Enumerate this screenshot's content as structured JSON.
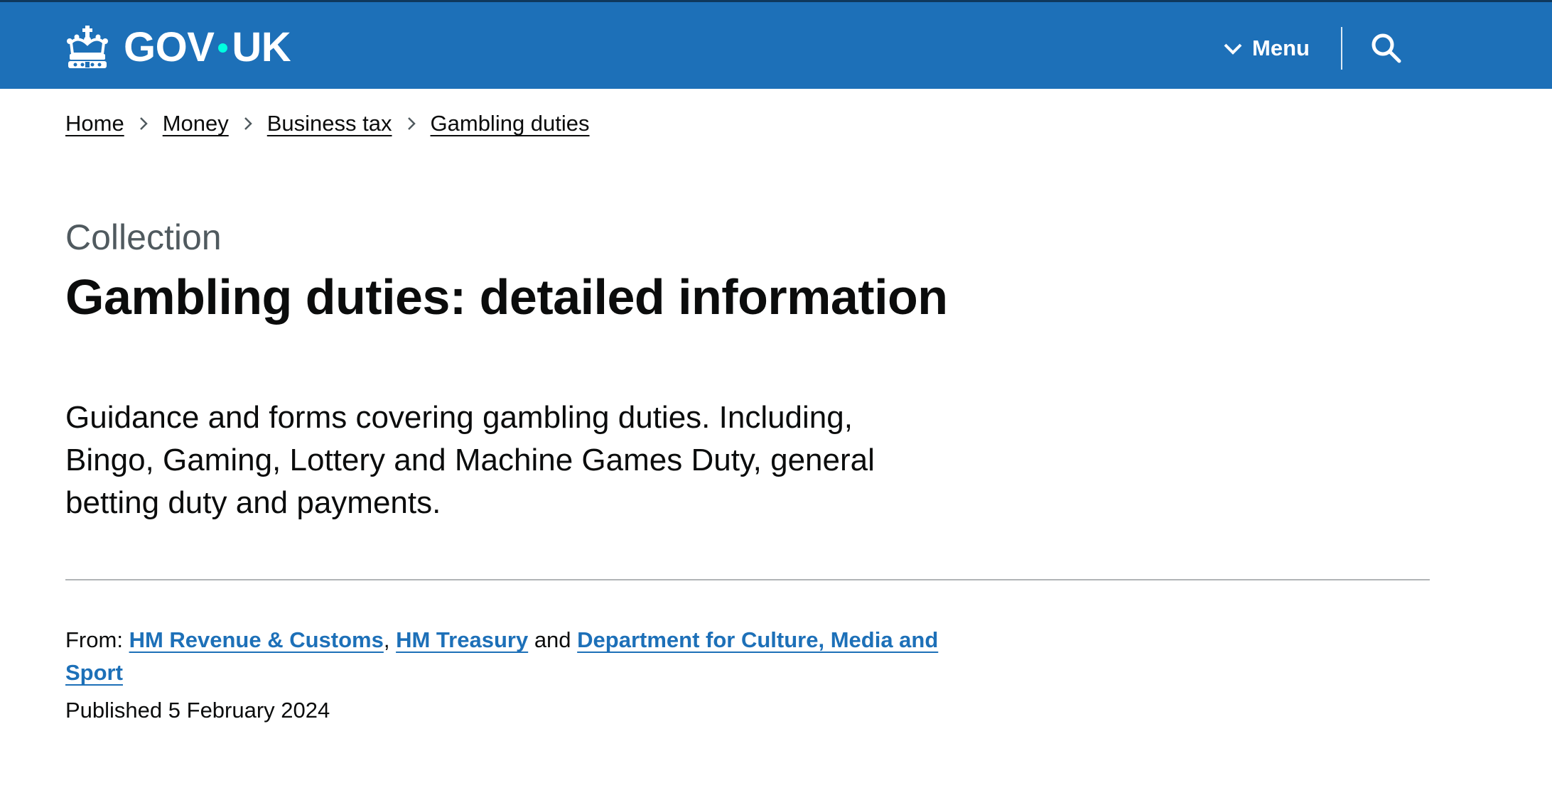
{
  "header": {
    "logo_text_left": "GOV",
    "logo_text_right": "UK",
    "menu_label": "Menu",
    "menu_icon": "chevron-down-icon",
    "search_icon": "search-icon",
    "logo_icon": "crown-icon",
    "background_color": "#1d70b8"
  },
  "breadcrumbs": [
    {
      "label": "Home"
    },
    {
      "label": "Money"
    },
    {
      "label": "Business tax"
    },
    {
      "label": "Gambling duties"
    }
  ],
  "page": {
    "caption": "Collection",
    "title": "Gambling duties: detailed information",
    "lead": "Guidance and forms covering gambling duties. Including, Bingo, Gaming, Lottery and Machine Games Duty, general betting duty and payments."
  },
  "metadata": {
    "from_label": "From:",
    "organisations": [
      {
        "label": "HM Revenue & Customs"
      },
      {
        "label": "HM Treasury"
      },
      {
        "label": "Department for Culture, Media and Sport"
      }
    ],
    "separator_comma": ",",
    "separator_and": "and",
    "published_label": "Published",
    "published_date": "5 February 2024",
    "link_color": "#1d70b8"
  }
}
